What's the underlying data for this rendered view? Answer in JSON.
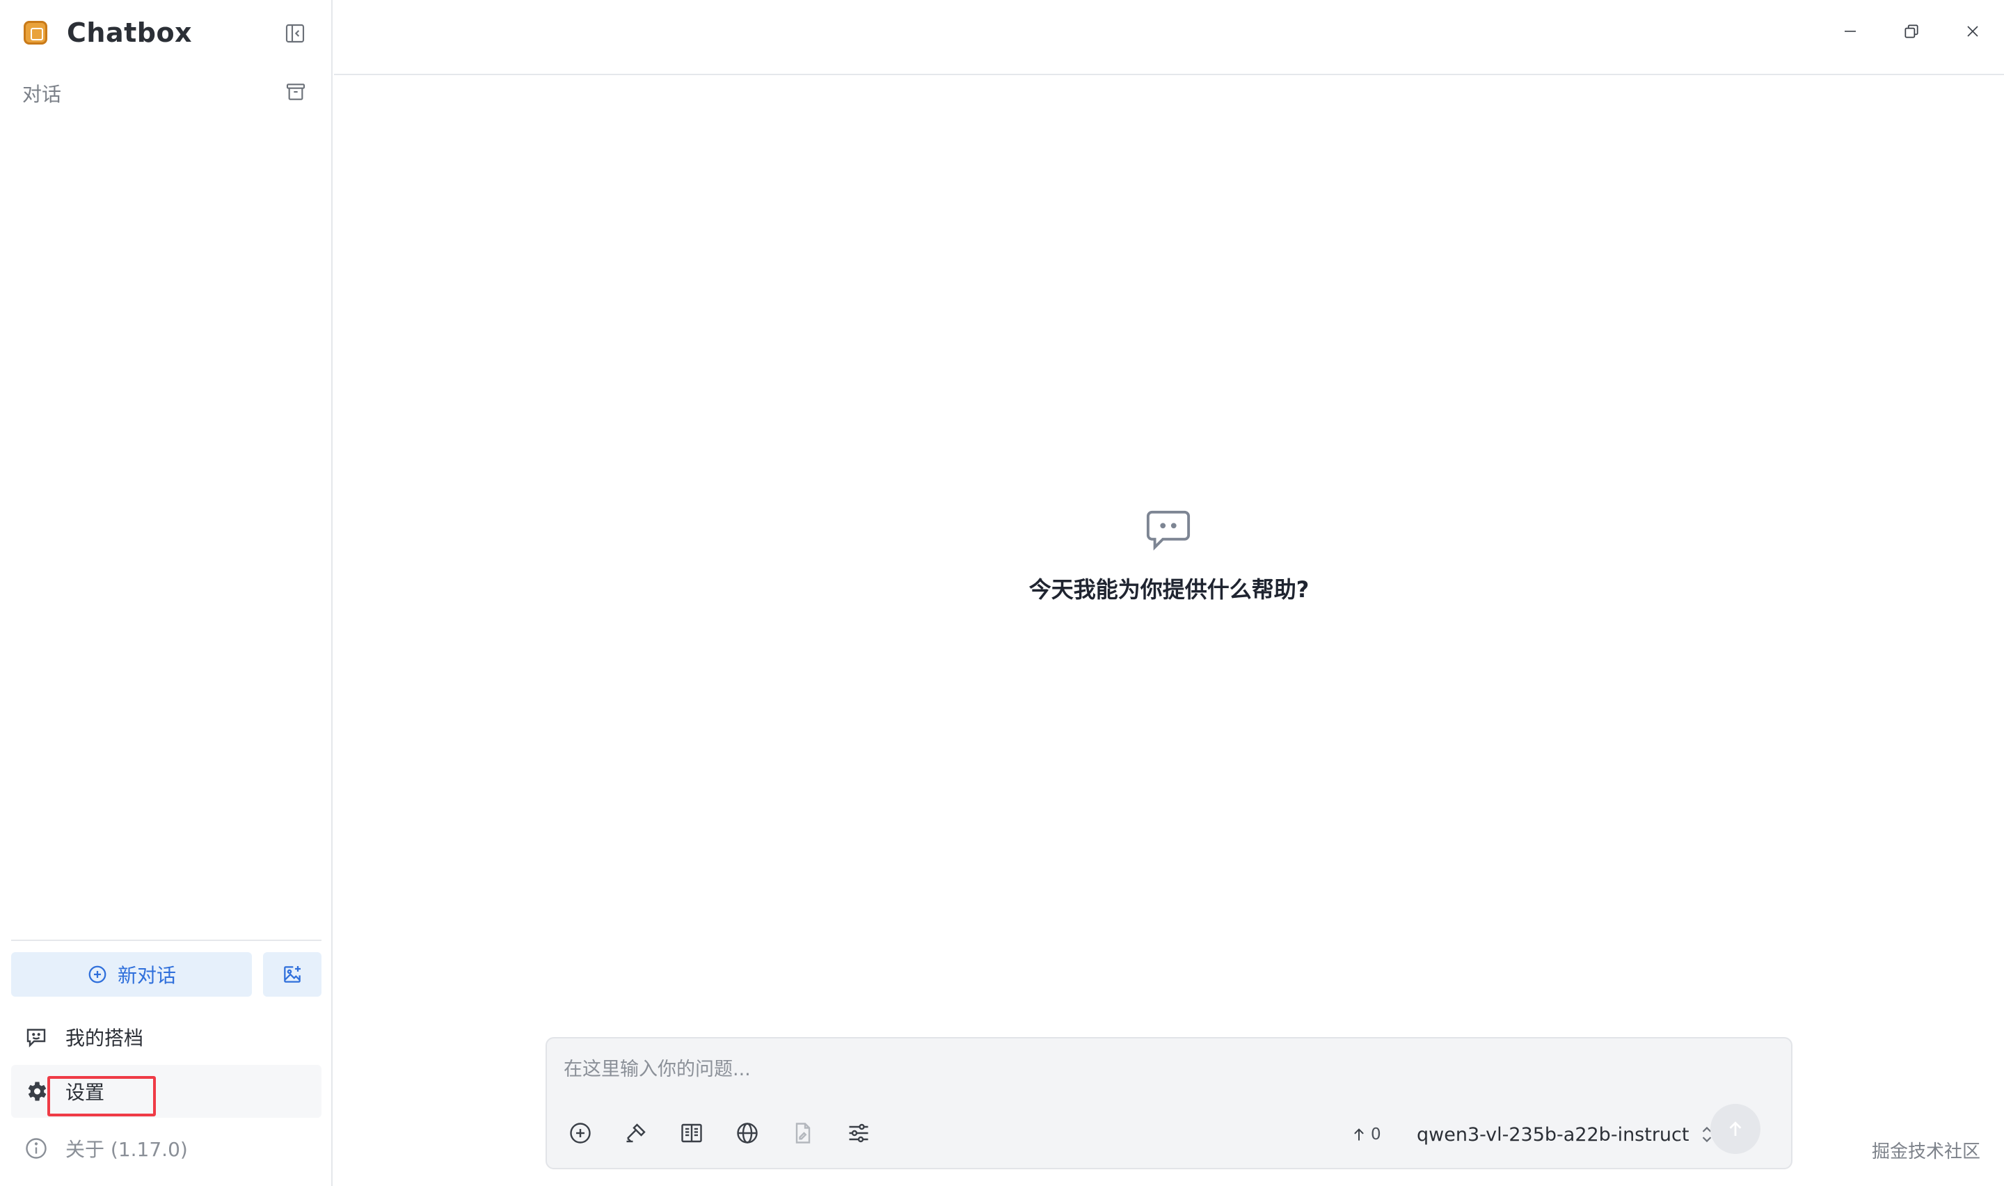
{
  "sidebar": {
    "brand_title": "Chatbox",
    "section_label": "对话",
    "new_chat_label": "新对话",
    "nav": {
      "copilot_label": "我的搭档",
      "settings_label": "设置",
      "about_label": "关于 (1.17.0)"
    }
  },
  "main": {
    "welcome_text": "今天我能为你提供什么帮助?",
    "composer": {
      "placeholder": "在这里输入你的问题...",
      "token_count": "0",
      "model_name": "qwen3-vl-235b-a22b-instruct"
    }
  },
  "watermark": "掘金技术社区",
  "colors": {
    "accent": "#2f6fdb",
    "accent_bg": "#e6f0fb",
    "highlight": "#ef3b46",
    "logo": "#e9a23b"
  },
  "icons": {
    "brand": "chatbox-logo-icon",
    "collapse": "sidebar-collapse-icon",
    "archive": "archive-icon",
    "new_chat": "plus-circle-icon",
    "new_image": "image-plus-icon",
    "copilot": "chat-smile-icon",
    "settings": "gear-icon",
    "about": "info-icon",
    "minimize": "minimize-icon",
    "maximize": "restore-icon",
    "close": "close-icon",
    "welcome": "chat-bubble-icon",
    "attach": "plus-circle-icon",
    "tools": "hammer-icon",
    "knowledge": "book-icon",
    "web": "globe-icon",
    "file": "file-icon",
    "options": "sliders-icon",
    "token": "arrow-up-icon",
    "model_toggle": "chevron-updown-icon",
    "send": "send-arrow-icon"
  }
}
